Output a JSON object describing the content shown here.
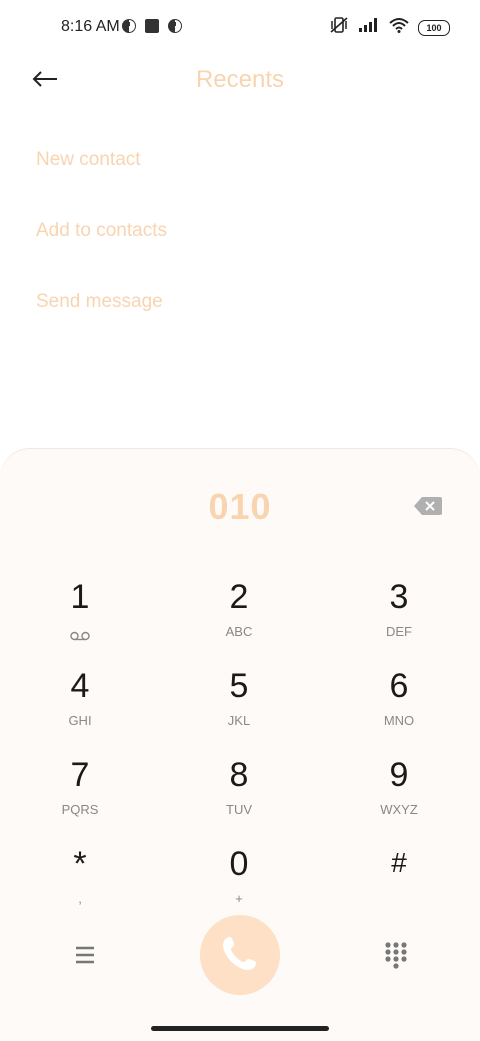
{
  "status_bar": {
    "time": "8:16 AM",
    "battery": "100",
    "left_icons": [
      "app-notification-icon",
      "square-notification-icon",
      "app-notification-icon"
    ],
    "right_icons": [
      "vibrate-off-icon",
      "signal-icon",
      "wifi-icon",
      "battery-icon"
    ]
  },
  "header": {
    "title": "Recents",
    "back_icon": "back-arrow-icon"
  },
  "actions": [
    {
      "label": "New contact"
    },
    {
      "label": "Add to contacts"
    },
    {
      "label": "Send message"
    }
  ],
  "dialer": {
    "number": "010",
    "backspace_icon": "backspace-icon",
    "keys": [
      {
        "digit": "1",
        "letters": ""
      },
      {
        "digit": "2",
        "letters": "ABC"
      },
      {
        "digit": "3",
        "letters": "DEF"
      },
      {
        "digit": "4",
        "letters": "GHI"
      },
      {
        "digit": "5",
        "letters": "JKL"
      },
      {
        "digit": "6",
        "letters": "MNO"
      },
      {
        "digit": "7",
        "letters": "PQRS"
      },
      {
        "digit": "8",
        "letters": "TUV"
      },
      {
        "digit": "9",
        "letters": "WXYZ"
      },
      {
        "digit": "*",
        "letters": ","
      },
      {
        "digit": "0",
        "letters": "+"
      },
      {
        "digit": "#",
        "letters": ""
      }
    ],
    "bottom_icons": [
      "menu-icon",
      "phone-icon",
      "dialpad-icon"
    ]
  },
  "colors": {
    "accent": "#f8d4b0",
    "call_button": "#fde0c6",
    "panel_bg": "#fdfaf7"
  }
}
